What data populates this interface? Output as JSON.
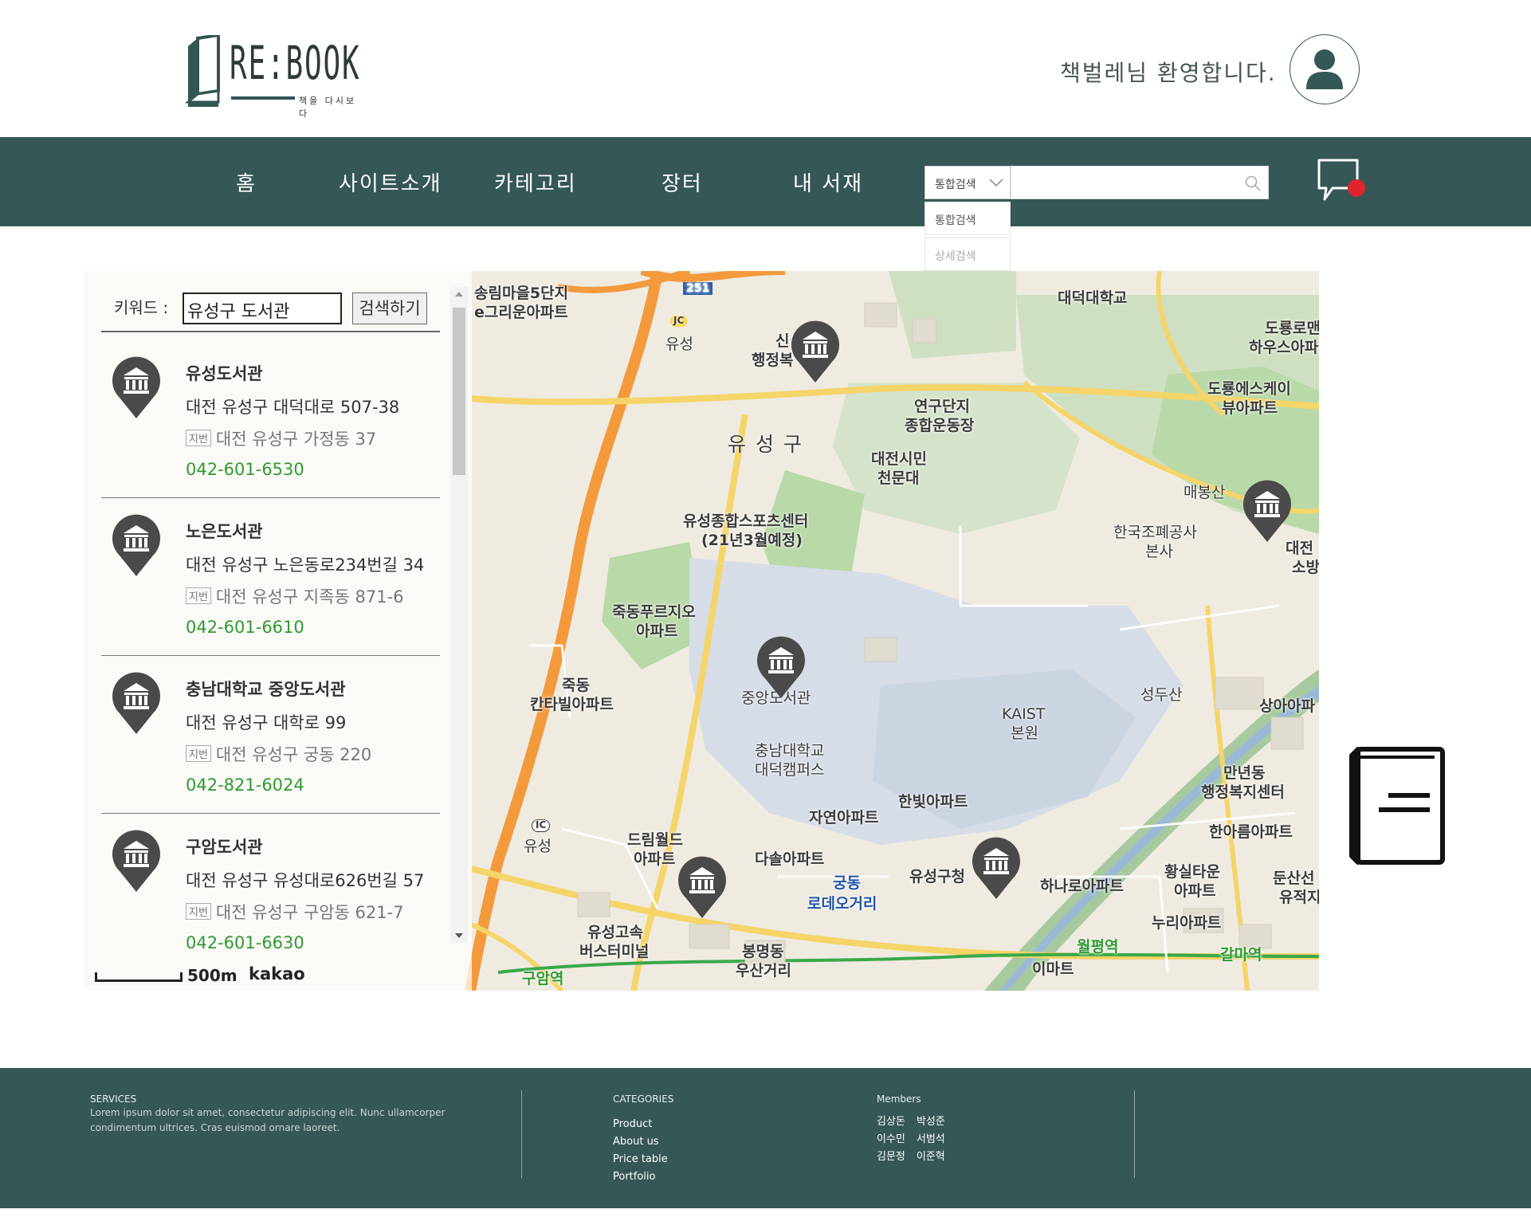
{
  "header": {
    "logo_text": "RE:BOOK",
    "logo_sub": "책을 다시보다",
    "welcome": "책벌레님 환영합니다."
  },
  "nav": {
    "items": [
      "홈",
      "사이트소개",
      "카테고리",
      "장터",
      "내 서재"
    ],
    "search_select": "통합검색",
    "search_placeholder": "",
    "dropdown_options": [
      "통합검색",
      "상세검색"
    ]
  },
  "map": {
    "keyword_label": "키워드 :",
    "keyword_value": "유성구 도서관",
    "search_button": "검색하기",
    "results": [
      {
        "name": "유성도서관",
        "address": "대전 유성구 대덕대로 507-38",
        "jibun": "대전 유성구 가정동 37",
        "tel": "042-601-6530"
      },
      {
        "name": "노은도서관",
        "address": "대전 유성구 노은동로234번길 34",
        "jibun": "대전 유성구 지족동 871-6",
        "tel": "042-601-6610"
      },
      {
        "name": "충남대학교 중앙도서관",
        "address": "대전 유성구 대학로 99",
        "jibun": "대전 유성구 궁동 220",
        "tel": "042-821-6024"
      },
      {
        "name": "구암도서관",
        "address": "대전 유성구 유성대로626번길 57",
        "jibun": "대전 유성구 구암동 621-7",
        "tel": "042-601-6630"
      }
    ],
    "jibun_tag": "지번",
    "scale": "500m",
    "attribution": "kakao",
    "labels": {
      "l1": "송림마을5단지",
      "l2": "e그리운아파트",
      "l3": "대덕대학교",
      "l4": "도룡로맨",
      "l5": "하우스아파",
      "l6": "도룡에스케이",
      "l7": "뷰아파트",
      "l8": "연구단지",
      "l9": "종합운동장",
      "l10": "유 성 구",
      "l11": "대전시민",
      "l12": "천문대",
      "l13": "매봉산",
      "l14": "한국조폐공사",
      "l15": "본사",
      "l16": "유성종합스포츠센터",
      "l17": "(21년3월예정)",
      "l18": "죽동푸르지오",
      "l19": "아파트",
      "l20": "죽동",
      "l21": "칸타빌아파트",
      "l22": "중앙도서관",
      "l23": "KAIST",
      "l24": "본원",
      "l25": "성두산",
      "l26": "충남대학교",
      "l27": "대덕캠퍼스",
      "l28": "만년동",
      "l29": "행정복지센터",
      "l30": "자연아파트",
      "l31": "한빛아파트",
      "l32": "한아름아파트",
      "l33": "드림월드",
      "l34": "아파트",
      "l35": "다솔아파트",
      "l36": "궁동",
      "l37": "로데오거리",
      "l38": "유성구청",
      "l39": "하나로아파트",
      "l40": "황실타운",
      "l41": "아파트",
      "l42": "누리아파트",
      "l43": "유성고속",
      "l44": "버스터미널",
      "l45": "봉명동",
      "l46": "우산거리",
      "l47": "이마트",
      "l48": "월평역",
      "l49": "갈마역",
      "l50": "유성",
      "l51": "유성",
      "l52": "251",
      "l53": "JC",
      "l54": "IC",
      "l55": "행정복",
      "l56": "신",
      "l57": "상아아파",
      "l58": "둔산선",
      "l59": "유적지",
      "l60": "대전",
      "l61": "소방",
      "l62": "구암역"
    }
  },
  "footer": {
    "services_title": "SERVICES",
    "services_text": "Lorem ipsum dolor sit amet, consectetur adipiscing elit. Nunc ullamcorper condimentum ultrices. Cras euismod ornare laoreet.",
    "categories_title": "CATEGORIES",
    "categories": [
      "Product",
      "About us",
      "Price table",
      "Portfolio"
    ],
    "members_title": "Members",
    "members": [
      [
        "김상돈",
        "박성준"
      ],
      [
        "이수민",
        "서범석"
      ],
      [
        "김문정",
        "이준혁"
      ]
    ]
  },
  "colors": {
    "brand": "#355755",
    "tel": "#2f9a2f",
    "notify": "#e0232c",
    "pin": "#4a4a4a"
  }
}
